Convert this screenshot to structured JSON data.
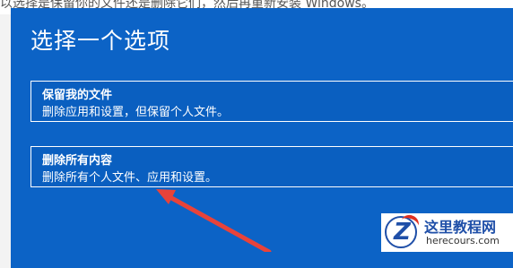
{
  "background": {
    "partial_text": "以选择是保留你的文件还是删除它们，然后再重新安装 Windows。"
  },
  "dialog": {
    "title": "选择一个选项",
    "options": [
      {
        "title": "保留我的文件",
        "description": "删除应用和设置，但保留个人文件。"
      },
      {
        "title": "删除所有内容",
        "description": "删除所有个人文件、应用和设置。"
      }
    ]
  },
  "annotation": {
    "arrow_color": "#e8433a"
  },
  "watermark": {
    "name_cn": "这里教程网",
    "domain": "herecours.com",
    "logo_letter": "Z"
  },
  "colors": {
    "dialog_bg": "#0c63c6",
    "text": "#ffffff",
    "arrow": "#e8433a",
    "watermark_blue": "#1f4fa8"
  }
}
